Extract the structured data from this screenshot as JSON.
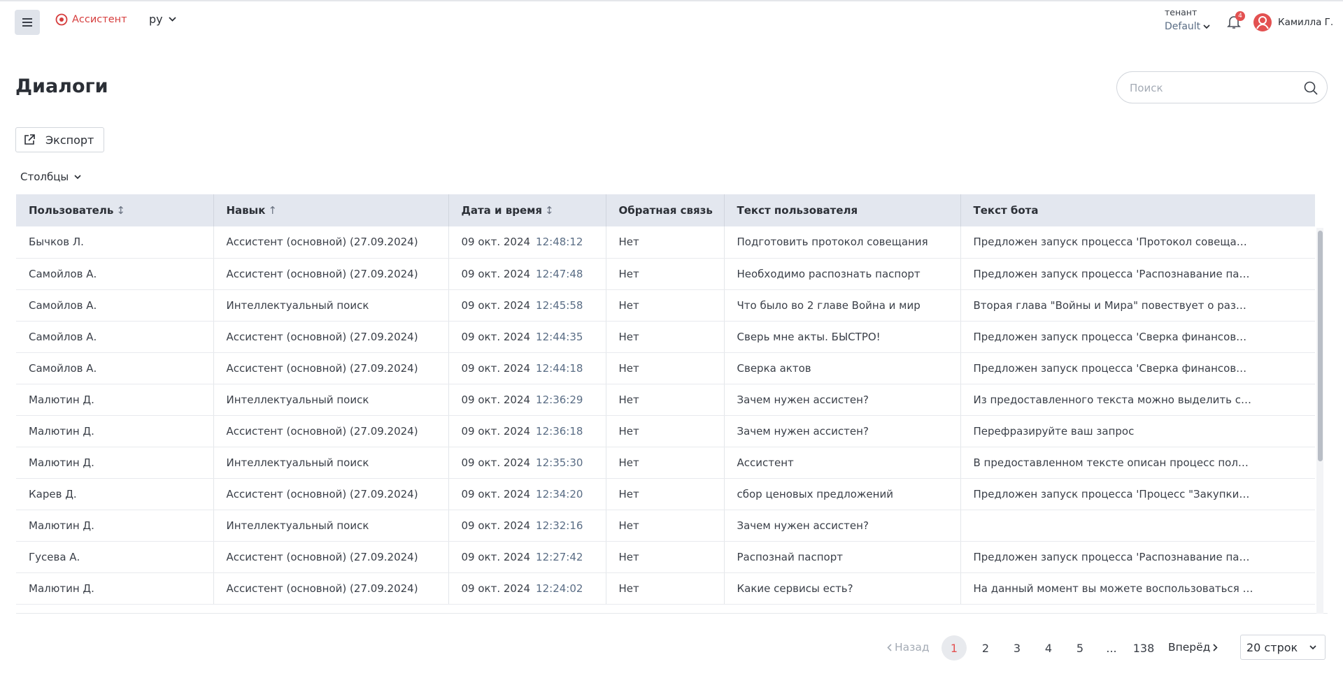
{
  "header": {
    "brand": "Ассистент",
    "language": "ру",
    "tenant_label": "тенант",
    "tenant_value": "Default",
    "notifications_count": "4",
    "user_name": "Камилла Г."
  },
  "page": {
    "title": "Диалоги",
    "search_placeholder": "Поиск",
    "export_label": "Экспорт",
    "columns_label": "Столбцы"
  },
  "table": {
    "columns": [
      "Пользователь",
      "Навык",
      "Дата и время",
      "Обратная связь",
      "Текст пользователя",
      "Текст бота"
    ],
    "rows": [
      {
        "user": "Бычков Л.",
        "skill": "Ассистент (основной) (27.09.2024)",
        "date": "09 окт. 2024",
        "time": "12:48:12",
        "feedback": "Нет",
        "user_text": "Подготовить протокол совещания",
        "bot_text": "Предложен запуск процесса 'Протокол совеща…"
      },
      {
        "user": "Самойлов А.",
        "skill": "Ассистент (основной) (27.09.2024)",
        "date": "09 окт. 2024",
        "time": "12:47:48",
        "feedback": "Нет",
        "user_text": "Необходимо распознать паспорт",
        "bot_text": "Предложен запуск процесса 'Распознавание па…"
      },
      {
        "user": "Самойлов А.",
        "skill": "Интеллектуальный поиск",
        "date": "09 окт. 2024",
        "time": "12:45:58",
        "feedback": "Нет",
        "user_text": "Что было во 2 главе Война и мир",
        "bot_text": "Вторая глава \"Войны и Мира\" повествует о раз…"
      },
      {
        "user": "Самойлов А.",
        "skill": "Ассистент (основной) (27.09.2024)",
        "date": "09 окт. 2024",
        "time": "12:44:35",
        "feedback": "Нет",
        "user_text": "Сверь мне акты. БЫСТРО!",
        "bot_text": "Предложен запуск процесса 'Сверка финансов…"
      },
      {
        "user": "Самойлов А.",
        "skill": "Ассистент (основной) (27.09.2024)",
        "date": "09 окт. 2024",
        "time": "12:44:18",
        "feedback": "Нет",
        "user_text": "Сверка актов",
        "bot_text": "Предложен запуск процесса 'Сверка финансов…"
      },
      {
        "user": "Малютин Д.",
        "skill": "Интеллектуальный поиск",
        "date": "09 окт. 2024",
        "time": "12:36:29",
        "feedback": "Нет",
        "user_text": "Зачем нужен ассистен?",
        "bot_text": "Из предоставленного текста можно выделить с…"
      },
      {
        "user": "Малютин Д.",
        "skill": "Ассистент (основной) (27.09.2024)",
        "date": "09 окт. 2024",
        "time": "12:36:18",
        "feedback": "Нет",
        "user_text": "Зачем нужен ассистен?",
        "bot_text": "Перефразируйте ваш запрос"
      },
      {
        "user": "Малютин Д.",
        "skill": "Интеллектуальный поиск",
        "date": "09 окт. 2024",
        "time": "12:35:30",
        "feedback": "Нет",
        "user_text": "Ассистент",
        "bot_text": "В предоставленном тексте описан процесс пол…"
      },
      {
        "user": "Карев Д.",
        "skill": "Ассистент (основной) (27.09.2024)",
        "date": "09 окт. 2024",
        "time": "12:34:20",
        "feedback": "Нет",
        "user_text": "сбор ценовых предложений",
        "bot_text": "Предложен запуск процесса 'Процесс \"Закупки…"
      },
      {
        "user": "Малютин Д.",
        "skill": "Интеллектуальный поиск",
        "date": "09 окт. 2024",
        "time": "12:32:16",
        "feedback": "Нет",
        "user_text": "Зачем нужен ассистен?",
        "bot_text": ""
      },
      {
        "user": "Гусева А.",
        "skill": "Ассистент (основной) (27.09.2024)",
        "date": "09 окт. 2024",
        "time": "12:27:42",
        "feedback": "Нет",
        "user_text": "Распознай паспорт",
        "bot_text": "Предложен запуск процесса 'Распознавание па…"
      },
      {
        "user": "Малютин Д.",
        "skill": "Ассистент (основной) (27.09.2024)",
        "date": "09 окт. 2024",
        "time": "12:24:02",
        "feedback": "Нет",
        "user_text": "Какие сервисы есть?",
        "bot_text": "На данный момент вы можете воспользоваться …"
      }
    ]
  },
  "pagination": {
    "prev_label": "Назад",
    "next_label": "Вперёд",
    "pages": [
      "1",
      "2",
      "3",
      "4",
      "5",
      "...",
      "138"
    ],
    "current_page": "1",
    "rows_per_page": "20 строк"
  },
  "colors": {
    "brand": "#d63d3d",
    "header_bg": "#e3e7ef",
    "time_text": "#5a6d85",
    "badge": "#e35151"
  }
}
